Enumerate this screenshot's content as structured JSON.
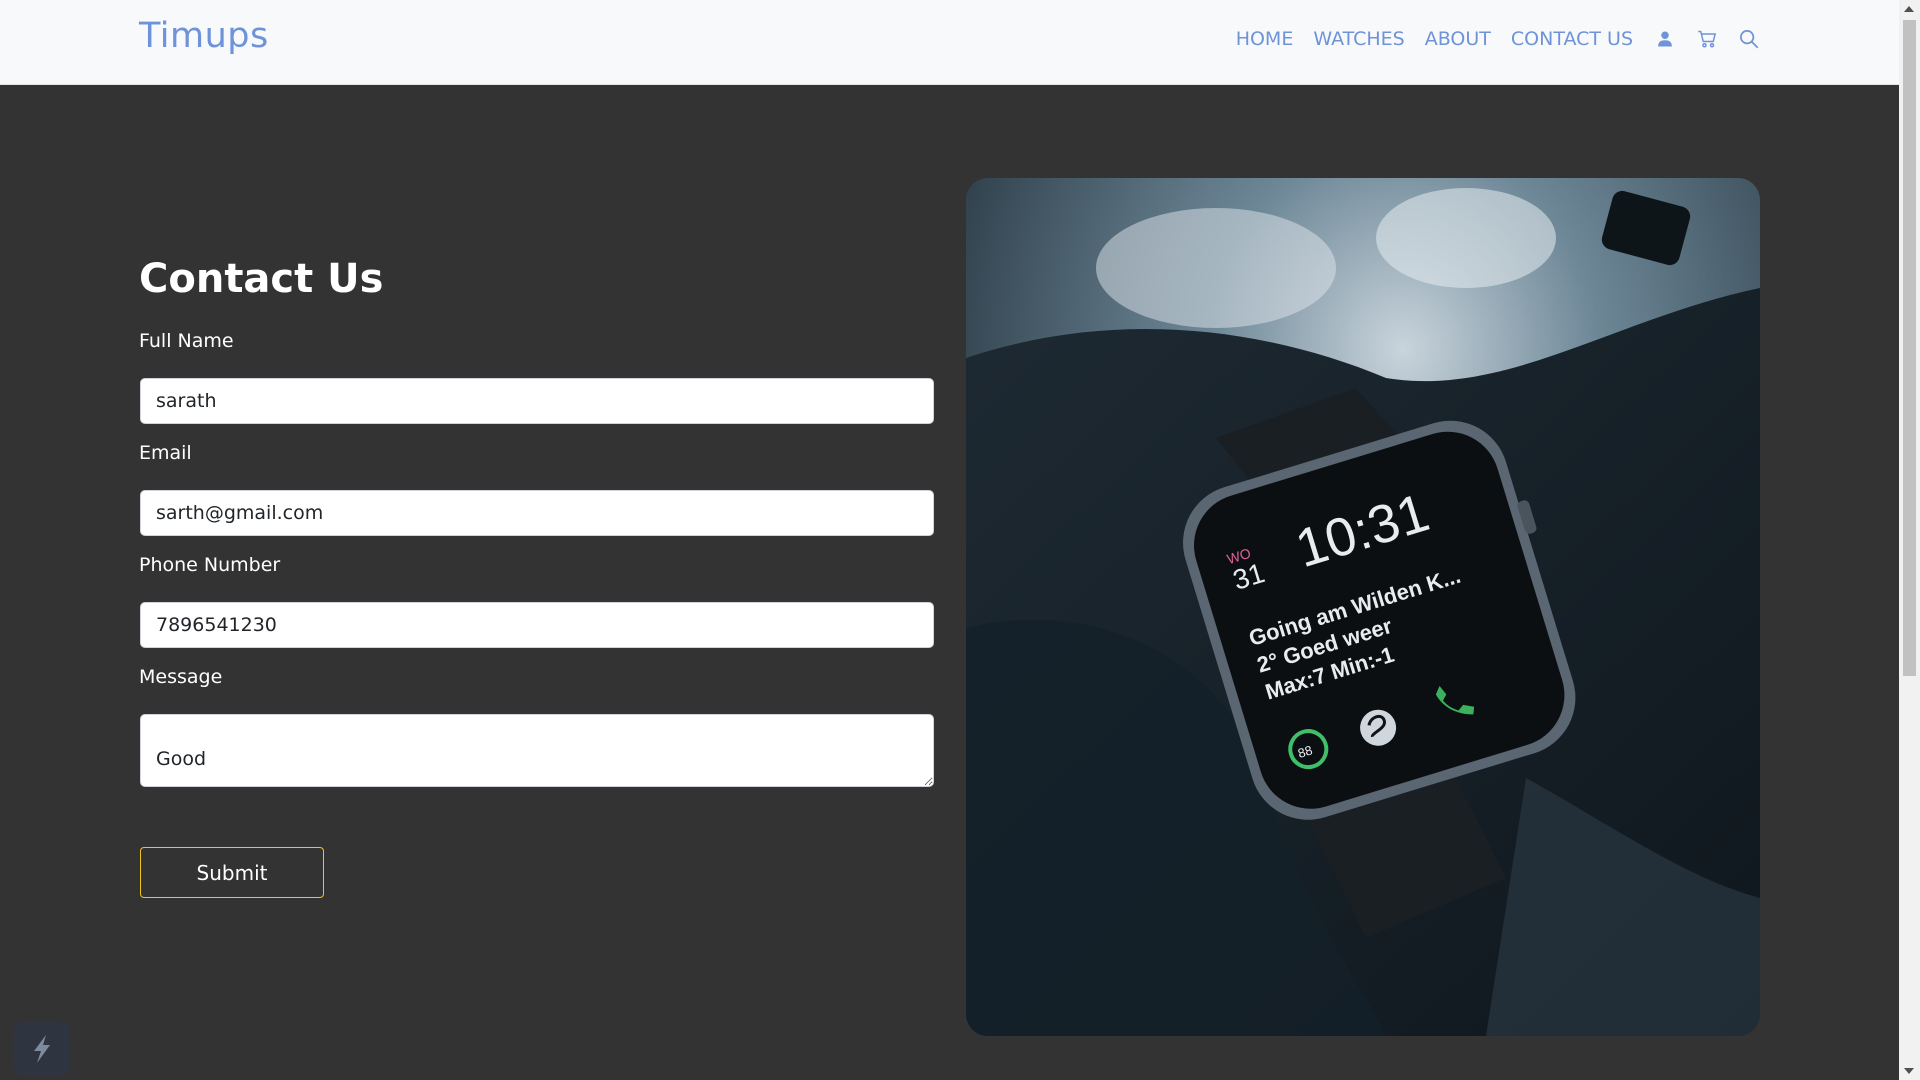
{
  "header": {
    "brand": "Timups",
    "nav": [
      "HOME",
      "WATCHES",
      "ABOUT",
      "CONTACT US"
    ],
    "icons": [
      "user-icon",
      "cart-icon",
      "search-icon"
    ]
  },
  "form": {
    "title": "Contact Us",
    "full_name_label": "Full Name",
    "full_name_value": "sarath",
    "email_label": "Email",
    "email_value": "sarth@gmail.com",
    "phone_label": "Phone Number",
    "phone_value": "7896541230",
    "message_label": "Message",
    "message_value": "Good",
    "submit_label": "Submit"
  },
  "watch": {
    "day_abbr": "WO",
    "day_num": "31",
    "time": "10:31",
    "line1": "Going am Wilden K...",
    "line2": "2° Goed weer",
    "line3": "Max:7 Min:-1",
    "ring_value": "88"
  },
  "colors": {
    "brand": "#6f93d8",
    "background": "#333333",
    "submit_border": "#f0c420"
  }
}
